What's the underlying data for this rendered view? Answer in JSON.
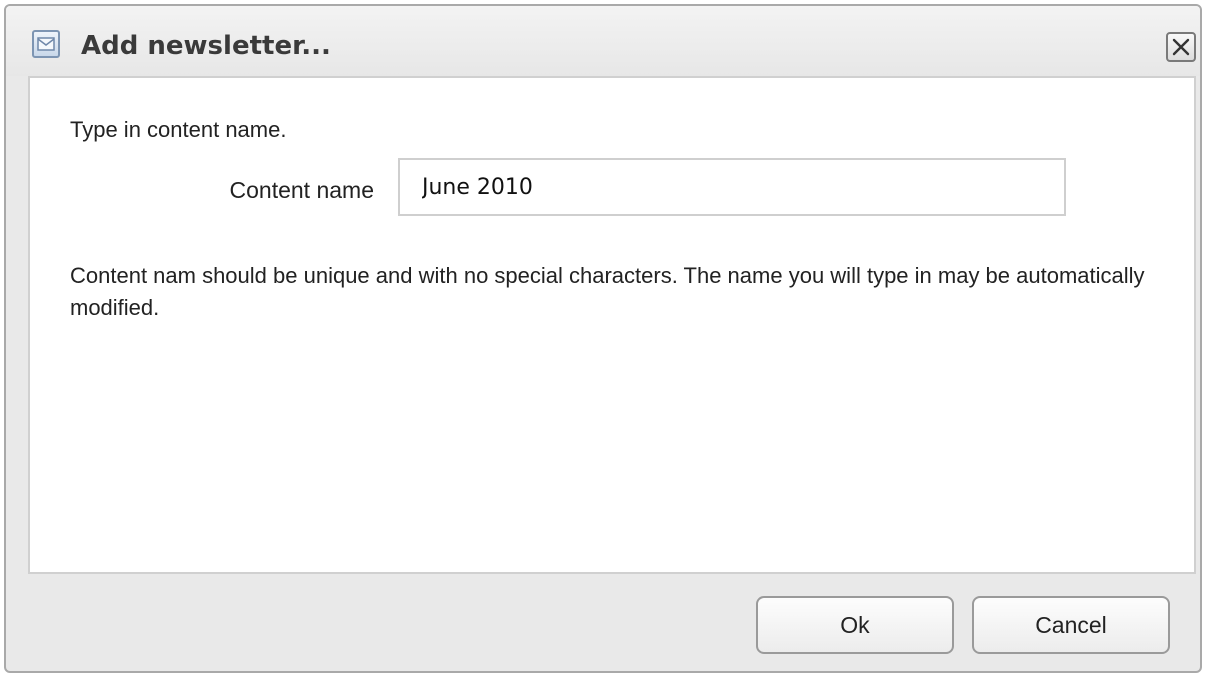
{
  "dialog": {
    "title": "Add newsletter...",
    "icon": "newsletter-icon",
    "close_icon": "close-icon"
  },
  "form": {
    "instruction": "Type in content name.",
    "field_label": "Content name",
    "field_value": "June 2010",
    "hint": "Content nam should be unique and with no special characters. The name you will type in may be automatically modified."
  },
  "buttons": {
    "ok_label": "Ok",
    "cancel_label": "Cancel"
  }
}
